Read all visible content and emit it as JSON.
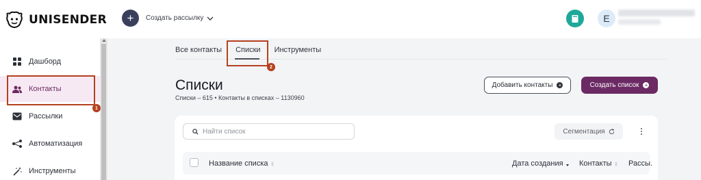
{
  "header": {
    "logo_text": "UNISENDER",
    "create_mailing": "Создать рассылку",
    "avatar_initial": "E"
  },
  "sidebar": {
    "items": [
      {
        "label": "Дашборд",
        "icon": "grid-icon"
      },
      {
        "label": "Контакты",
        "icon": "users-icon",
        "active": true
      },
      {
        "label": "Рассылки",
        "icon": "mail-icon"
      },
      {
        "label": "Автоматизация",
        "icon": "share-nodes-icon"
      },
      {
        "label": "Инструменты",
        "icon": "magic-wand-icon"
      }
    ]
  },
  "tabs": [
    {
      "label": "Все контакты"
    },
    {
      "label": "Списки",
      "active": true
    },
    {
      "label": "Инструменты"
    }
  ],
  "page": {
    "title": "Списки",
    "stats": "Списки – 615  •  Контакты в списках – 1130960"
  },
  "buttons": {
    "add_contacts": "Добавить контакты",
    "create_list": "Создать список",
    "segmentation": "Сегментация"
  },
  "search": {
    "placeholder": "Найти список"
  },
  "table": {
    "columns": [
      "Название списка",
      "Дата создания",
      "Контакты",
      "Рассы."
    ]
  },
  "annotations": [
    {
      "number": "1",
      "target": "Контакты"
    },
    {
      "number": "2",
      "target": "Списки"
    }
  ],
  "colors": {
    "brand": "#6b2a63",
    "annotation": "#b4411f",
    "teal": "#1fa89a",
    "active_bg": "#f7e9f3"
  }
}
